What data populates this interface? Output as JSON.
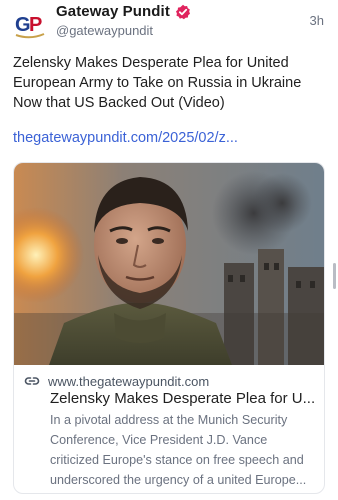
{
  "author": {
    "display_name": "Gateway Pundit",
    "handle": "@gatewaypundit",
    "avatar_text": "GP",
    "verified_icon": "verified-badge-icon",
    "verified_color": "#e0245e"
  },
  "post": {
    "timestamp": "3h",
    "text": "Zelensky Makes Desperate Plea for United European Army to Take on Russia in Ukraine Now that US Backed Out (Video)",
    "link_text": "thegatewaypundit.com/2025/02/z...",
    "link_color": "#3b62d6"
  },
  "link_card": {
    "image_alt": "Man with beard in olive jacket in front of smoke and damaged buildings",
    "link_icon": "link-icon",
    "domain": "www.thegatewaypundit.com",
    "title": "Zelensky Makes Desperate Plea for U...",
    "description": "In a pivotal address at the Munich Security Conference, Vice President J.D. Vance criticized Europe's stance on free speech and underscored the urgency of a united Europe..."
  }
}
